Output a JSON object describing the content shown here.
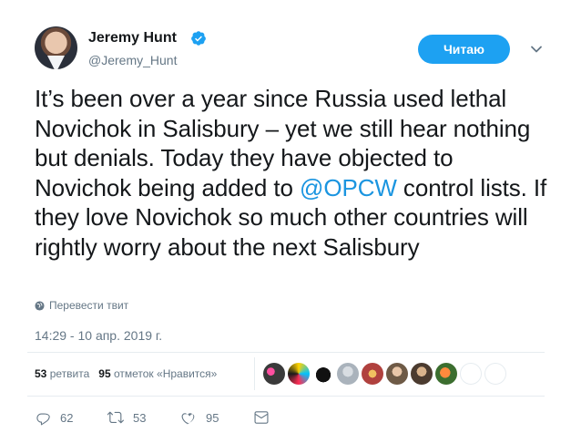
{
  "author": {
    "name": "Jeremy Hunt",
    "handle": "@Jeremy_Hunt",
    "verified": true
  },
  "follow_button": {
    "label": "Читаю"
  },
  "tweet": {
    "text_before_mention": "It’s been over a year since Russia used lethal Novichok in Salisbury – yet we still hear nothing but denials. Today they have objected to Novichok being added to ",
    "mention": "@OPCW",
    "text_after_mention": " control lists. If they love Novichok so much other countries will rightly worry about the next Salisbury"
  },
  "translate_link": "Перевести твит",
  "timestamp": "14:29 - 10 апр. 2019 г.",
  "stats": {
    "retweets_count": "53",
    "retweets_label": "ретвита",
    "likes_count": "95",
    "likes_label": "отметок «Нравится»"
  },
  "actions": {
    "reply_count": "62",
    "retweet_count": "53",
    "like_count": "95"
  },
  "colors": {
    "accent": "#1da1f2",
    "link": "#1b95e0",
    "secondary_text": "#657786"
  }
}
